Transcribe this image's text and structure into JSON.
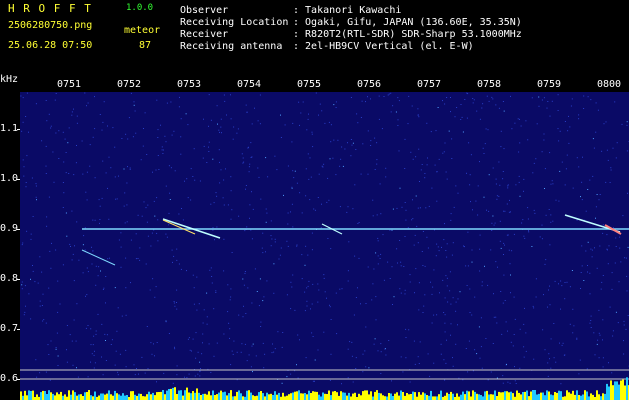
{
  "header": {
    "app_title": "H R O F F T",
    "app_version": "1.0.0",
    "file_name": "2506280750.png",
    "meteor_label": "meteor",
    "timestamp": "25.06.28 07:50",
    "meteor_count": "87"
  },
  "info": [
    {
      "label": "Observer",
      "value": ": Takanori Kawachi"
    },
    {
      "label": "Receiving Location",
      "value": ": Ogaki, Gifu, JAPAN (136.60E, 35.35N)"
    },
    {
      "label": "Receiver",
      "value": ": R820T2(RTL-SDR) SDR-Sharp 53.1000MHz"
    },
    {
      "label": "Receiving antenna",
      "value": ": 2el-HB9CV Vertical (el. E-W)"
    }
  ],
  "axis": {
    "y_unit": "kHz",
    "y_labels": [
      "1.1",
      "1.0",
      "0.9",
      "0.8",
      "0.7",
      "0.6"
    ],
    "x_labels": [
      "0751",
      "0752",
      "0753",
      "0754",
      "0755",
      "0756",
      "0757",
      "0758",
      "0759",
      "0800"
    ]
  },
  "colors": {
    "background": "#000000",
    "spectrogram_bg": "#0a0a66",
    "noise_dots": "#2a3fc8",
    "carrier": "#7fd9ff",
    "meteor_trace": "#bfffff",
    "ref_lines": "#c8c8c8",
    "level_bars": "#ffff00",
    "level_fill": "#20c8ff",
    "text_yellow": "#ffff33",
    "text_green": "#33ff33"
  }
}
